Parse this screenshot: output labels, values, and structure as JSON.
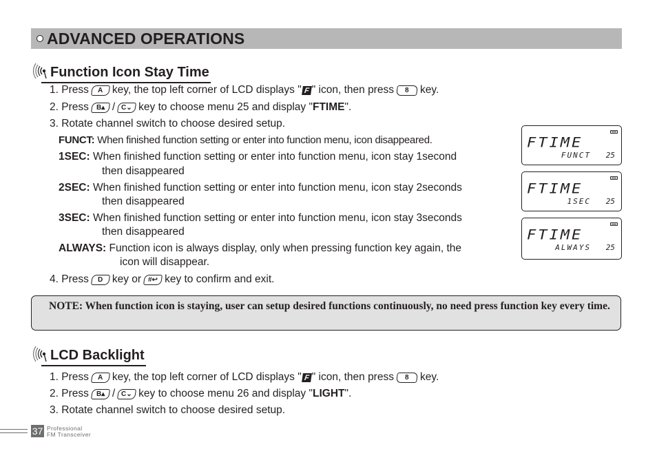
{
  "banner": {
    "title": "ADVANCED OPERATIONS"
  },
  "section1": {
    "heading": "Function Icon Stay Time",
    "steps": [
      {
        "num": "1. Press",
        "key": "A",
        "text1": "key, the top left corner of LCD displays \"",
        "icon": "F",
        "text2": "\" icon, then press",
        "key2": "8",
        "text3": "key."
      },
      {
        "num": "2. Press",
        "key_b": "B▴",
        "sep": "/",
        "key_c": "C⌄",
        "text1": "key to choose menu 25 and display \"",
        "bold": "FTIME",
        "text2": "\"."
      },
      {
        "text": "3. Rotate channel switch to choose desired setup."
      },
      {
        "num": "4. Press",
        "key_d": "D",
        "text1": "key or",
        "key_hash": "#↩",
        "text2": "key to confirm and exit."
      }
    ],
    "options": [
      {
        "label": "FUNCT:",
        "desc": "When finished function setting or enter into function menu, icon disappeared."
      },
      {
        "label": "1SEC:",
        "desc": "When finished function setting or enter into function menu, icon stay 1second",
        "cont": "then disappeared"
      },
      {
        "label": "2SEC:",
        "desc": "When finished function setting or enter into function menu, icon stay 2seconds",
        "cont": "then disappeared"
      },
      {
        "label": "3SEC:",
        "desc": "When finished function setting or enter into function menu, icon stay 3seconds",
        "cont": "then disappeared"
      },
      {
        "label": "ALWAYS:",
        "desc": "Function icon is always display, only when pressing function key again, the",
        "cont": "icon will disappear."
      }
    ],
    "lcds": [
      {
        "main": "FTIME",
        "value": "FUNCT",
        "menu": "25",
        "icon": "battery-icon"
      },
      {
        "main": "FTIME",
        "value": "1SEC",
        "menu": "25",
        "icon": "battery-icon"
      },
      {
        "main": "FTIME",
        "value": "ALWAYS",
        "menu": "25",
        "icon": "battery-icon"
      }
    ]
  },
  "note": {
    "text": "NOTE: When function icon is staying, user can setup desired functions continuously, no need press function key every time."
  },
  "section2": {
    "heading": "LCD Backlight",
    "steps": [
      {
        "num": "1. Press",
        "key": "A",
        "text1": "key, the top left corner of LCD displays \"",
        "icon": "F",
        "text2": "\" icon, then press",
        "key2": "8",
        "text3": "key."
      },
      {
        "num": "2. Press",
        "key_b": "B▴",
        "sep": "/",
        "key_c": "C⌄",
        "text1": "key to choose menu 26 and display \"",
        "bold": "LIGHT",
        "text2": "\"."
      },
      {
        "text": "3. Rotate channel switch to choose desired setup."
      }
    ]
  },
  "footer": {
    "page": "37",
    "brand_line1": "Professional",
    "brand_line2": "FM Transceiver"
  }
}
